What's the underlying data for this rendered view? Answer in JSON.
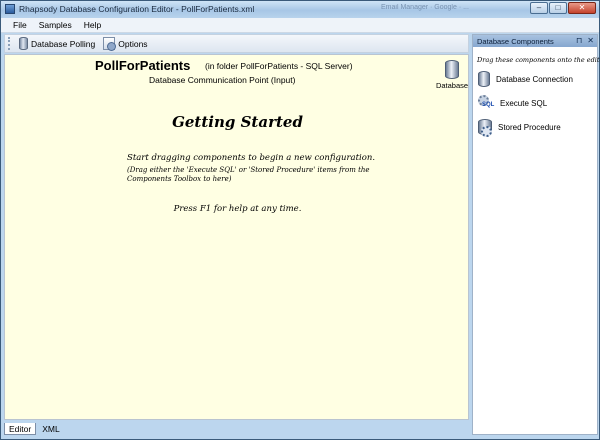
{
  "window": {
    "title": "Rhapsody Database Configuration Editor - PollForPatients.xml",
    "background_tabs": "Email Manager  ·  Google  ·  ...",
    "controls": [
      "–",
      "□",
      "✕"
    ]
  },
  "menu": [
    "File",
    "Samples",
    "Help"
  ],
  "toolbar": {
    "database_polling_label": "Database Polling",
    "options_label": "Options"
  },
  "editor": {
    "connection_name": "PollForPatients",
    "folder_note": "(in folder PollForPatients - SQL Server)",
    "point_description": "Database Communication Point (Input)",
    "db_icon_label": "Database",
    "getting_started": {
      "heading": "Getting Started",
      "line1": "Start dragging components to begin a new configuration.",
      "line2": "(Drag either the 'Execute SQL' or 'Stored Procedure' items from the Components Toolbox to here)",
      "help": "Press F1 for help at any time."
    }
  },
  "bottom_tabs": [
    {
      "label": "Editor",
      "active": true
    },
    {
      "label": "XML",
      "active": false
    }
  ],
  "panel": {
    "title": "Database Components",
    "pin": "⊓",
    "close": "✕",
    "hint": "Drag these components onto the editor",
    "items": [
      {
        "label": "Database Connection",
        "icon": "database-icon"
      },
      {
        "label": "Execute SQL",
        "icon": "execute-sql-icon"
      },
      {
        "label": "Stored Procedure",
        "icon": "stored-procedure-icon"
      }
    ]
  },
  "colors": {
    "editor_background": "#ffffe3",
    "chrome": "#bcd6ee",
    "panel_header": "#86a7cf"
  }
}
